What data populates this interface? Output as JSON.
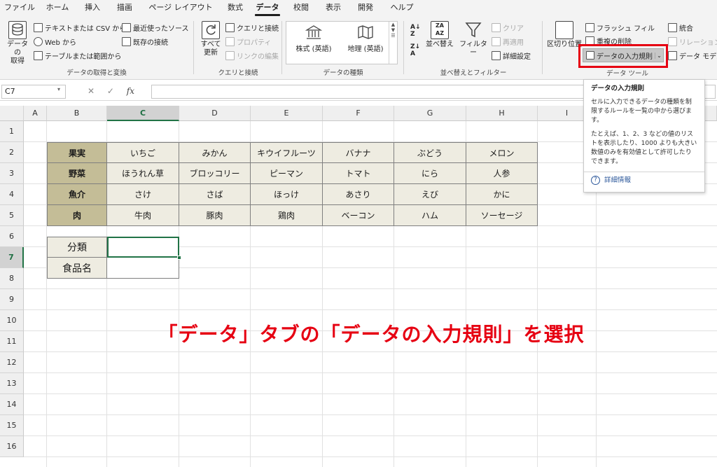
{
  "menu": {
    "tabs": [
      "ファイル",
      "ホーム",
      "挿入",
      "描画",
      "ページ レイアウト",
      "数式",
      "データ",
      "校閲",
      "表示",
      "開発",
      "ヘルプ"
    ],
    "active": "データ"
  },
  "ribbon": {
    "get_data": {
      "big_label_1": "データの",
      "big_label_2": "取得",
      "from_csv": "テキストまたは CSV から",
      "from_web": "Web から",
      "from_table": "テーブルまたは範囲から",
      "recent_sources": "最近使ったソース",
      "existing_connections": "既存の接続",
      "group_label": "データの取得と変換"
    },
    "queries": {
      "refresh_1": "すべて",
      "refresh_2": "更新",
      "queries_connections": "クエリと接続",
      "properties": "プロパティ",
      "edit_links": "リンクの編集",
      "group_label": "クエリと接続"
    },
    "data_types": {
      "stocks": "株式 (英語)",
      "geography": "地理 (英語)",
      "group_label": "データの種類"
    },
    "sort_filter": {
      "sort": "並べ替え",
      "filter": "フィルター",
      "clear": "クリア",
      "reapply": "再適用",
      "advanced": "詳細設定",
      "group_label": "並べ替えとフィルター"
    },
    "data_tools": {
      "text_to_columns": "区切り位置",
      "flash_fill": "フラッシュ フィル",
      "remove_duplicates": "重複の削除",
      "data_validation": "データの入力規則",
      "consolidate": "統合",
      "relationships": "リレーションシ",
      "data_model": "データ モデルの",
      "group_label": "データ ツール"
    }
  },
  "formula_bar": {
    "name_box": "C7",
    "fx": "fx",
    "value": ""
  },
  "sheet": {
    "columns": [
      "A",
      "B",
      "C",
      "D",
      "E",
      "F",
      "G",
      "H",
      "I"
    ],
    "selected_column": "C",
    "rows": [
      "1",
      "2",
      "3",
      "4",
      "5",
      "6",
      "7",
      "8",
      "9",
      "10",
      "11",
      "12",
      "13",
      "14",
      "15",
      "16"
    ],
    "selected_row": "7",
    "table": [
      [
        "果実",
        "いちご",
        "みかん",
        "キウイフルーツ",
        "バナナ",
        "ぶどう",
        "メロン"
      ],
      [
        "野菜",
        "ほうれん草",
        "ブロッコリー",
        "ピーマン",
        "トマト",
        "にら",
        "人参"
      ],
      [
        "魚介",
        "さけ",
        "さば",
        "ほっけ",
        "あさり",
        "えび",
        "かに"
      ],
      [
        "肉",
        "牛肉",
        "豚肉",
        "鶏肉",
        "ベーコン",
        "ハム",
        "ソーセージ"
      ]
    ],
    "input_labels": [
      "分類",
      "食品名"
    ]
  },
  "tooltip": {
    "title": "データの入力規則",
    "para1": "セルに入力できるデータの種類を制限するルールを一覧の中から選びます。",
    "para2": "たとえば、1、2、3 などの値のリストを表示したり、1000 よりも大きい数値のみを有効値として許可したりできます。",
    "link": "詳細情報"
  },
  "annotation": "「データ」タブの「データの入力規則」を選択",
  "colors": {
    "accent_red": "#e60012",
    "excel_green": "#217346",
    "category_fill": "#c4bd97",
    "value_fill": "#eeece1"
  }
}
